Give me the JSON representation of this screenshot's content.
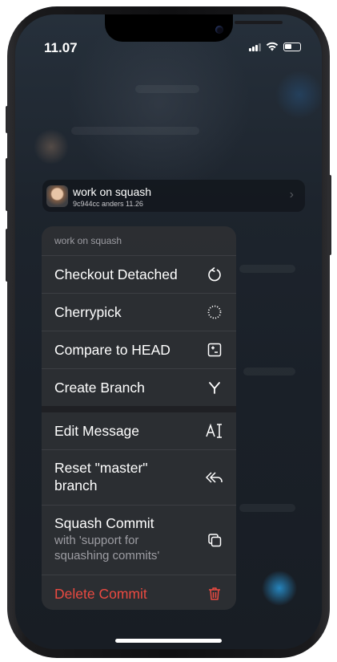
{
  "status_bar": {
    "time": "11.07"
  },
  "commit": {
    "title": "work on squash",
    "subtitle": "9c944cc anders 11.26"
  },
  "menu": {
    "header": "work on squash",
    "items": [
      {
        "label": "Checkout Detached",
        "icon": "circular-arrow-icon"
      },
      {
        "label": "Cherrypick",
        "icon": "dotted-circle-icon"
      },
      {
        "label": "Compare to HEAD",
        "icon": "plus-minus-box-icon"
      },
      {
        "label": "Create Branch",
        "icon": "branch-merge-icon"
      },
      {
        "label": "Edit Message",
        "icon": "text-cursor-icon"
      },
      {
        "label": "Reset \"master\" branch",
        "icon": "reply-all-icon"
      },
      {
        "label": "Squash Commit",
        "sub": "with 'support for squashing commits'",
        "icon": "stack-squares-icon"
      },
      {
        "label": "Delete Commit",
        "icon": "trash-icon",
        "color": "#eb4a41"
      }
    ]
  }
}
